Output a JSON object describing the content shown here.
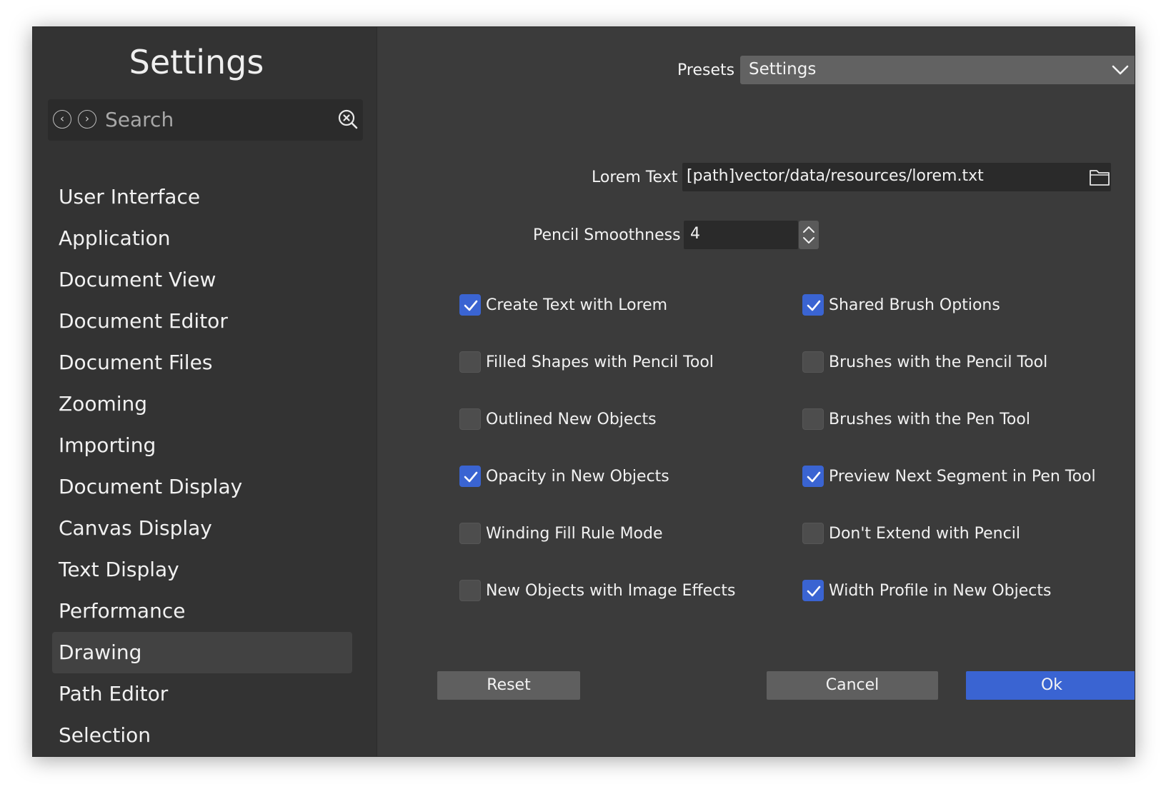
{
  "sidebar": {
    "title": "Settings",
    "search": {
      "placeholder": "Search"
    },
    "items": [
      {
        "label": "User Interface"
      },
      {
        "label": "Application"
      },
      {
        "label": "Document View"
      },
      {
        "label": "Document Editor"
      },
      {
        "label": "Document Files"
      },
      {
        "label": "Zooming"
      },
      {
        "label": "Importing"
      },
      {
        "label": "Document Display"
      },
      {
        "label": "Canvas Display"
      },
      {
        "label": "Text Display"
      },
      {
        "label": "Performance"
      },
      {
        "label": "Drawing"
      },
      {
        "label": "Path Editor"
      },
      {
        "label": "Selection"
      }
    ],
    "active_item": "Drawing"
  },
  "main": {
    "presets": {
      "label": "Presets",
      "value": "Settings"
    },
    "lorem_text": {
      "label": "Lorem Text",
      "value": "[path]vector/data/resources/lorem.txt"
    },
    "pencil_smoothness": {
      "label": "Pencil Smoothness",
      "value": "4"
    },
    "checkboxes_left": [
      {
        "label": "Create Text with Lorem",
        "checked": true
      },
      {
        "label": "Filled Shapes with Pencil Tool",
        "checked": false
      },
      {
        "label": "Outlined New Objects",
        "checked": false
      },
      {
        "label": "Opacity in New Objects",
        "checked": true
      },
      {
        "label": "Winding Fill Rule Mode",
        "checked": false
      },
      {
        "label": "New Objects with Image Effects",
        "checked": false
      }
    ],
    "checkboxes_right": [
      {
        "label": "Shared Brush Options",
        "checked": true
      },
      {
        "label": "Brushes with the Pencil Tool",
        "checked": false
      },
      {
        "label": "Brushes with the Pen Tool",
        "checked": false
      },
      {
        "label": "Preview Next Segment in Pen Tool",
        "checked": true
      },
      {
        "label": "Don't Extend with Pencil",
        "checked": false
      },
      {
        "label": "Width Profile in New Objects",
        "checked": true
      }
    ]
  },
  "footer": {
    "reset_label": "Reset",
    "cancel_label": "Cancel",
    "ok_label": "Ok"
  },
  "colors": {
    "accent": "#3a64d2",
    "panel": "#3b3b3b",
    "sidebar": "#333333"
  }
}
